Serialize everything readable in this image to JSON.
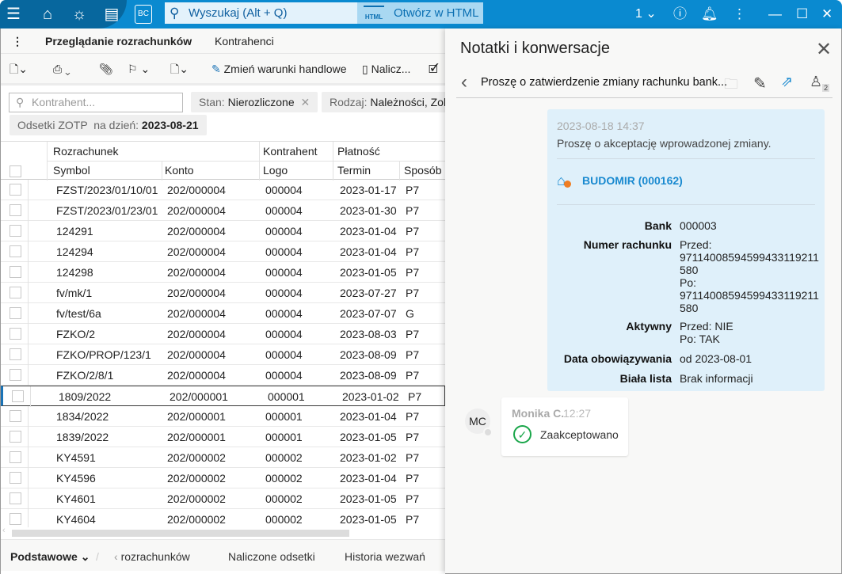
{
  "titlebar": {
    "search_placeholder": "Wyszukaj (Alt + Q)",
    "open_html": "Otwórz w HTML",
    "html_badge": "HTML",
    "bc_label": "BC",
    "company_selector": "1"
  },
  "tabs": [
    {
      "label": "Przeglądanie rozrachunków",
      "active": true
    },
    {
      "label": "Kontrahenci",
      "active": false
    }
  ],
  "toolbar": {
    "change_terms": "Zmień warunki handlowe",
    "calculate": "Nalicz..."
  },
  "filters": {
    "kontrahent_placeholder": "Kontrahent...",
    "stan_label": "Stan:",
    "stan_value": "Nierozliczone",
    "rodzaj_label": "Rodzaj:",
    "rodzaj_value": "Należności, Zob",
    "odsetki_label": "Odsetki ZOTP  na dzień:",
    "odsetki_value": "2023-08-21"
  },
  "grid": {
    "groups": {
      "rozrachunek": "Rozrachunek",
      "kontrahent": "Kontrahent",
      "platnosc": "Płatność"
    },
    "columns": {
      "symbol": "Symbol",
      "konto": "Konto",
      "logo": "Logo",
      "termin": "Termin",
      "sposob": "Sposób"
    },
    "rows": [
      [
        "FZST/2023/01/10/01",
        "202/000004",
        "000004",
        "2023-01-17",
        "P7"
      ],
      [
        "FZST/2023/01/23/01",
        "202/000004",
        "000004",
        "2023-01-30",
        "P7"
      ],
      [
        "124291",
        "202/000004",
        "000004",
        "2023-01-04",
        "P7"
      ],
      [
        "124294",
        "202/000004",
        "000004",
        "2023-01-04",
        "P7"
      ],
      [
        "124298",
        "202/000004",
        "000004",
        "2023-01-05",
        "P7"
      ],
      [
        "fv/mk/1",
        "202/000004",
        "000004",
        "2023-07-27",
        "P7"
      ],
      [
        "fv/test/6a",
        "202/000004",
        "000004",
        "2023-07-07",
        "G"
      ],
      [
        "FZKO/2",
        "202/000004",
        "000004",
        "2023-08-03",
        "P7"
      ],
      [
        "FZKO/PROP/123/1",
        "202/000004",
        "000004",
        "2023-08-09",
        "P7"
      ],
      [
        "FZKO/2/8/1",
        "202/000004",
        "000004",
        "2023-08-09",
        "P7"
      ],
      [
        "1809/2022",
        "202/000001",
        "000001",
        "2023-01-02",
        "P7"
      ],
      [
        "1834/2022",
        "202/000001",
        "000001",
        "2023-01-04",
        "P7"
      ],
      [
        "1839/2022",
        "202/000001",
        "000001",
        "2023-01-05",
        "P7"
      ],
      [
        "KY4591",
        "202/000002",
        "000002",
        "2023-01-02",
        "P7"
      ],
      [
        "KY4596",
        "202/000002",
        "000002",
        "2023-01-04",
        "P7"
      ],
      [
        "KY4601",
        "202/000002",
        "000002",
        "2023-01-05",
        "P7"
      ],
      [
        "KY4604",
        "202/000002",
        "000002",
        "2023-01-05",
        "P7"
      ]
    ],
    "selected_row": "1809/2022"
  },
  "bottombar": {
    "preset": "Podstawowe",
    "back": "rozrachunków",
    "tab1": "Naliczone odsetki",
    "tab2": "Historia wezwań"
  },
  "panel": {
    "title": "Notatki i konwersacje",
    "subject": "Proszę o zatwierdzenie zmiany rachunku bank...",
    "participants_count": "2",
    "message": {
      "timestamp": "2023-08-18 14:37",
      "text": "Proszę o akceptację wprowadzonej zmiany.",
      "link": "BUDOMIR (000162)",
      "fields": [
        {
          "key": "Bank",
          "value": "000003"
        },
        {
          "key": "Numer rachunku",
          "value": "Przed:\n97114008594599433119211580\nPo:\n97114008594599433119211580"
        },
        {
          "key": "Aktywny",
          "value": "Przed: NIE\nPo: TAK"
        },
        {
          "key": "Data obowiązywania",
          "value": "od 2023-08-01"
        },
        {
          "key": "Biała lista",
          "value": "Brak informacji"
        }
      ]
    },
    "reply": {
      "initials": "MC",
      "author": "Monika C.",
      "time": "12:27",
      "status": "Zaakceptowano"
    }
  },
  "colors": {
    "titlebar": "#0a8ad0",
    "accent": "#1a8fd4",
    "message_bg": "#dff0fa",
    "accepted": "#1aa64a",
    "link": "#1a8ad0"
  }
}
